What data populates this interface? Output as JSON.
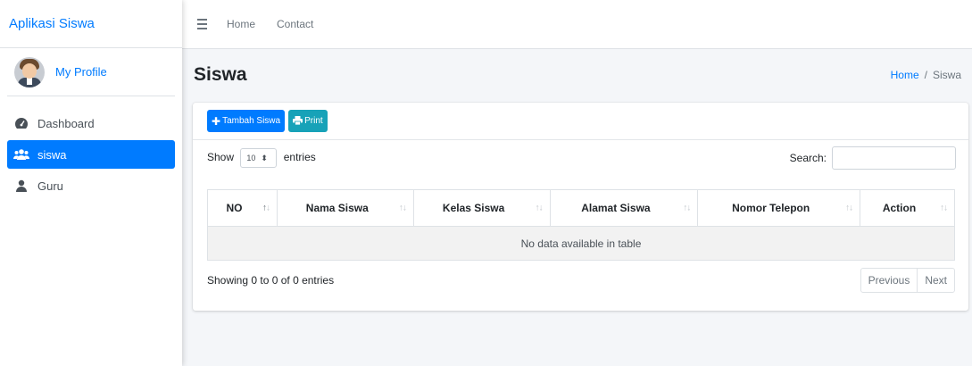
{
  "brand": "Aplikasi Siswa",
  "user": {
    "profile_label": "My Profile"
  },
  "sidebar": {
    "items": [
      {
        "label": "Dashboard",
        "icon": "tachometer-icon",
        "active": false
      },
      {
        "label": "siswa",
        "icon": "users-icon",
        "active": true
      },
      {
        "label": "Guru",
        "icon": "user-icon",
        "active": false
      }
    ]
  },
  "topnav": {
    "links": [
      "Home",
      "Contact"
    ]
  },
  "header": {
    "title": "Siswa",
    "breadcrumb": [
      "Home",
      "Siswa"
    ]
  },
  "toolbar": {
    "add_label": "Tambah Siswa",
    "print_label": "Print"
  },
  "datatable": {
    "show_label": "Show",
    "entries_value": "10",
    "entries_label": "entries",
    "search_label": "Search:",
    "search_value": "",
    "columns": [
      "NO",
      "Nama Siswa",
      "Kelas Siswa",
      "Alamat Siswa",
      "Nomor Telepon",
      "Action"
    ],
    "empty_message": "No data available in table",
    "info": "Showing 0 to 0 of 0 entries",
    "previous": "Previous",
    "next": "Next"
  },
  "colors": {
    "primary": "#007bff",
    "info": "#17a2b8",
    "background": "#f4f6f9"
  }
}
